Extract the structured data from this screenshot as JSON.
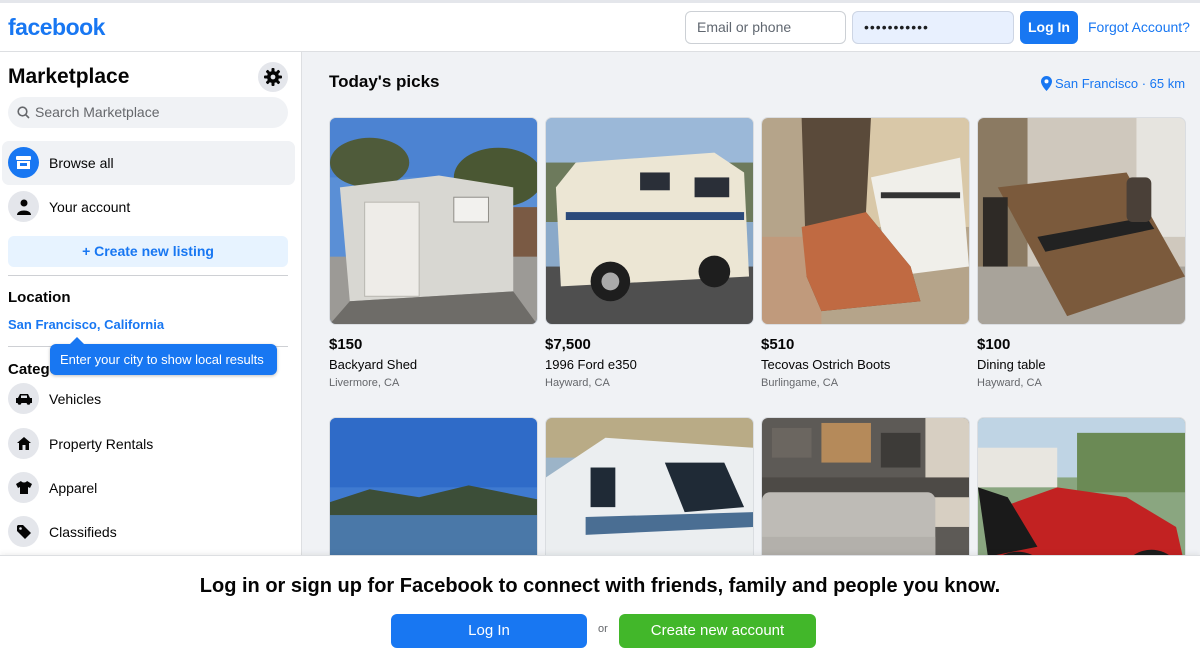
{
  "header": {
    "logo": "facebook",
    "email_placeholder": "Email or phone",
    "password_value": "•••••••••••",
    "login_label": "Log In",
    "forgot_label": "Forgot Account?"
  },
  "sidebar": {
    "title": "Marketplace",
    "settings_icon": "gear-icon",
    "search_placeholder": "Search Marketplace",
    "nav": [
      {
        "label": "Browse all",
        "icon": "storefront-icon",
        "active": true
      },
      {
        "label": "Your account",
        "icon": "person-icon",
        "active": false
      }
    ],
    "create_listing": "+ Create new listing",
    "location_heading": "Location",
    "location_value": "San Francisco, California",
    "tooltip": "Enter your city to show local results",
    "categories_heading": "Categories",
    "categories": [
      {
        "label": "Vehicles",
        "icon": "car-icon"
      },
      {
        "label": "Property Rentals",
        "icon": "house-icon"
      },
      {
        "label": "Apparel",
        "icon": "shirt-icon"
      },
      {
        "label": "Classifieds",
        "icon": "tag-icon"
      }
    ]
  },
  "main": {
    "title": "Today's picks",
    "location_link": "San Francisco · 65 km",
    "listings": [
      {
        "price": "$150",
        "title": "Backyard Shed",
        "location": "Livermore, CA"
      },
      {
        "price": "$7,500",
        "title": "1996 Ford e350",
        "location": "Hayward, CA"
      },
      {
        "price": "$510",
        "title": "Tecovas Ostrich Boots",
        "location": "Burlingame, CA"
      },
      {
        "price": "$100",
        "title": "Dining table",
        "location": "Hayward, CA"
      }
    ]
  },
  "banner": {
    "text": "Log in or sign up for Facebook to connect with friends, family and people you know.",
    "login_label": "Log In",
    "or_label": "or",
    "create_label": "Create new account"
  },
  "colors": {
    "brand_blue": "#1877f2",
    "green": "#42b72a",
    "page_bg": "#f0f2f5"
  }
}
